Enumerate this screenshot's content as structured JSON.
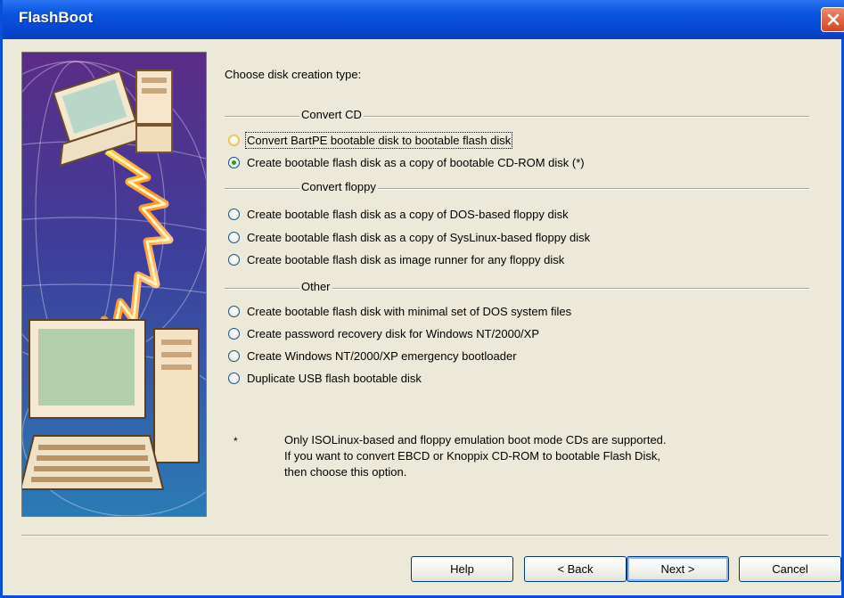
{
  "window": {
    "title": "FlashBoot"
  },
  "prompt": "Choose disk creation type:",
  "groups": {
    "convert_cd": "Convert CD",
    "convert_floppy": "Convert floppy",
    "other": "Other"
  },
  "options": [
    {
      "label": "Convert BartPE bootable disk to bootable flash disk",
      "state": "hover-focused"
    },
    {
      "label": "Create bootable flash disk as a copy of bootable CD-ROM disk (*)",
      "state": "selected"
    },
    {
      "label": "Create bootable flash disk as a copy of DOS-based floppy disk"
    },
    {
      "label": "Create bootable flash disk as a copy of SysLinux-based floppy disk"
    },
    {
      "label": "Create bootable flash disk as image runner for any floppy disk"
    },
    {
      "label": "Create bootable flash disk with minimal set of DOS system files"
    },
    {
      "label": "Create password recovery disk for Windows NT/2000/XP"
    },
    {
      "label": "Create Windows NT/2000/XP emergency bootloader"
    },
    {
      "label": "Duplicate USB flash bootable disk"
    }
  ],
  "note": {
    "marker": "*",
    "lines": [
      "Only ISOLinux-based and floppy emulation boot mode CDs are supported.",
      "If you want to convert EBCD or Knoppix CD-ROM to bootable Flash Disk,",
      "then choose this option."
    ]
  },
  "buttons": {
    "help": "Help",
    "back": "< Back",
    "next": "Next >",
    "cancel": "Cancel"
  },
  "colors": {
    "titlebar": "#0a54e0",
    "dialog_bg": "#ece9d8",
    "selected_radio": "#21a121"
  }
}
